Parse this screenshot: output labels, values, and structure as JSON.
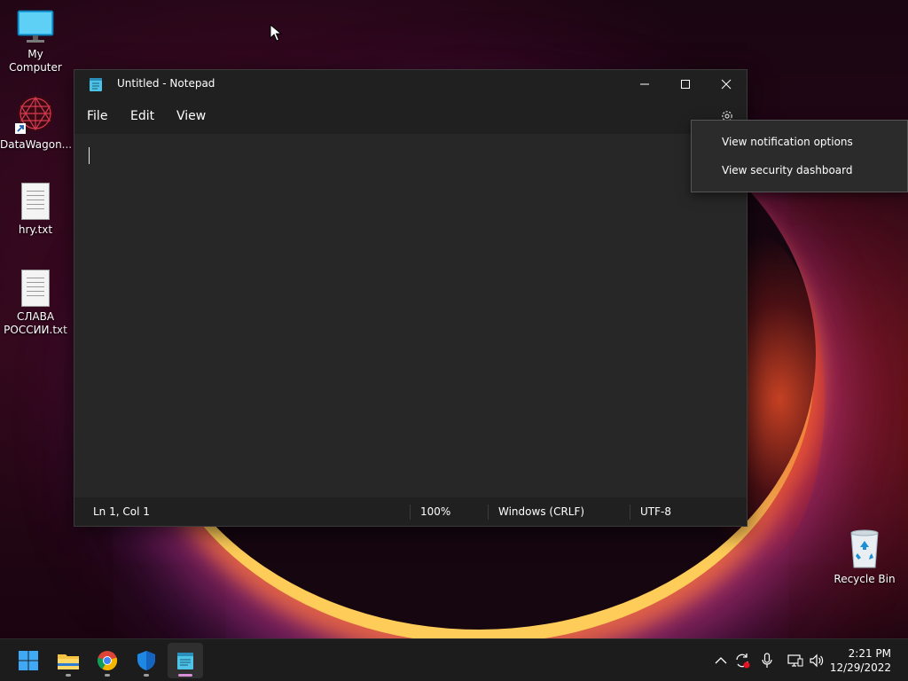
{
  "desktop": {
    "icons": [
      {
        "label": "My Computer",
        "icon": "monitor-icon"
      },
      {
        "label": "DataWagon...",
        "icon": "datawagon-shortcut-icon"
      },
      {
        "label": "hry.txt",
        "icon": "text-file-icon"
      },
      {
        "label": "СЛАВА РОССИИ.txt",
        "icon": "text-file-icon"
      },
      {
        "label": "Recycle Bin",
        "icon": "recycle-bin-icon"
      }
    ]
  },
  "notepad": {
    "title": "Untitled - Notepad",
    "menu": {
      "file": "File",
      "edit": "Edit",
      "view": "View"
    },
    "status": {
      "position": "Ln 1, Col 1",
      "zoom": "100%",
      "line_endings": "Windows (CRLF)",
      "encoding": "UTF-8"
    }
  },
  "context_menu": {
    "items": [
      "View notification options",
      "View security dashboard"
    ]
  },
  "taskbar": {
    "apps": [
      "start-icon",
      "file-explorer-icon",
      "chrome-icon",
      "windows-security-icon",
      "notepad-icon"
    ],
    "clock": {
      "time": "2:21 PM",
      "date": "12/29/2022"
    }
  },
  "colors": {
    "window_bg": "#272727",
    "titlebar_bg": "#202020",
    "taskbar_bg": "#1c1c1c",
    "active_indicator": "#d98fd8"
  }
}
